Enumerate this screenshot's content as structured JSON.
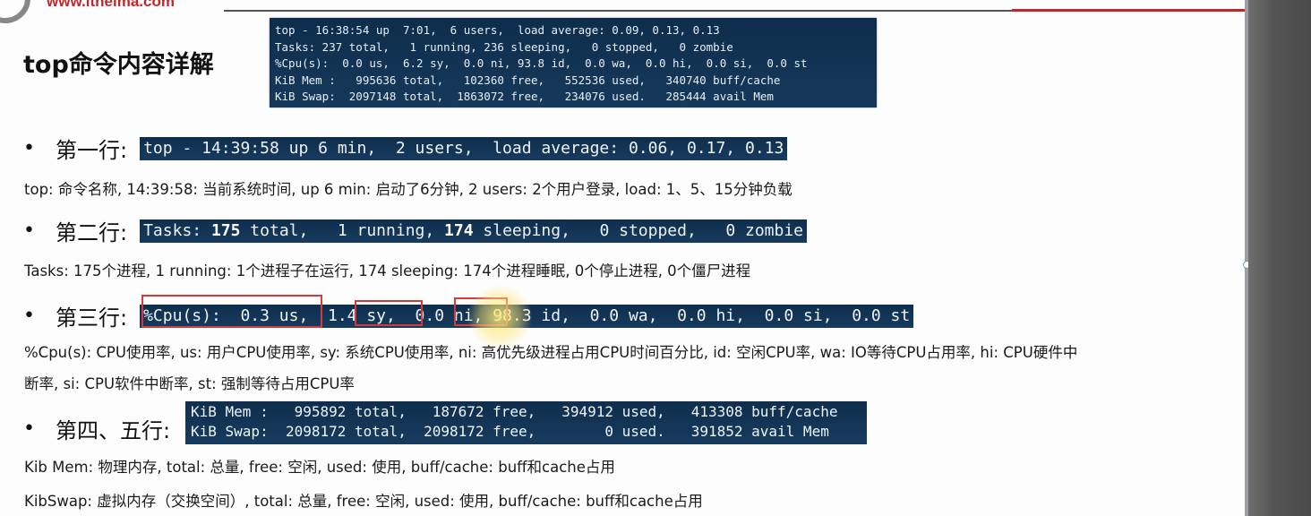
{
  "header": {
    "site": "www.itheima.com"
  },
  "title": "top命令内容详解",
  "top_terminal": [
    "top - 16:38:54 up  7:01,  6 users,  load average: 0.09, 0.13, 0.13",
    "Tasks: 237 total,   1 running, 236 sleeping,   0 stopped,   0 zombie",
    "%Cpu(s):  0.0 us,  6.2 sy,  0.0 ni, 93.8 id,  0.0 wa,  0.0 hi,  0.0 si,  0.0 st",
    "KiB Mem :   995636 total,   102360 free,   552536 used,   340740 buff/cache",
    "KiB Swap:  2097148 total,  1863072 free,   234076 used.   285444 avail Mem"
  ],
  "rows": {
    "row1": {
      "label": "第一行:",
      "line": "top - 14:39:58 up 6 min,  2 users,  load average: 0.06, 0.17, 0.13",
      "desc": "top: 命令名称, 14:39:58: 当前系统时间, up 6 min: 启动了6分钟, 2 users: 2个用户登录, load: 1、5、15分钟负载"
    },
    "row2": {
      "label": "第二行:",
      "line_parts": [
        "Tasks: ",
        "175",
        " total,   1 running, ",
        "174",
        " sleeping,   0 stopped,   0 zombie"
      ],
      "desc": "Tasks: 175个进程, 1 running: 1个进程子在运行, 174 sleeping: 174个进程睡眠, 0个停止进程, 0个僵尸进程"
    },
    "row3": {
      "label": "第三行:",
      "line": "%Cpu(s):  0.3 us,  1.4 sy,  0.0 ni, 98.3 id,  0.0 wa,  0.0 hi,  0.0 si,  0.0 st",
      "desc_line1": "%Cpu(s): CPU使用率, us: 用户CPU使用率, sy: 系统CPU使用率, ni: 高优先级进程占用CPU时间百分比, id: 空闲CPU率, wa: IO等待CPU占用率, hi: CPU硬件中",
      "desc_line2": "断率, si: CPU软件中断率, st: 强制等待占用CPU率"
    },
    "row45": {
      "label": "第四、五行:",
      "mem_lines": [
        "KiB Mem :   995892 total,   187672 free,   394912 used,   413308 buff/cache",
        "KiB Swap:  2098172 total,  2098172 free,        0 used.   391852 avail Mem"
      ],
      "desc_mem": "Kib Mem: 物理内存, total: 总量, free: 空闲, used: 使用, buff/cache: buff和cache占用",
      "desc_swap": "KibSwap: 虚拟内存（交换空间）, total: 总量, free: 空闲, used: 使用, buff/cache: buff和cache占用"
    }
  },
  "colors": {
    "terminal_bg": "#16395b",
    "highlight_box": "#d33a3a",
    "brand_red": "#c0272d"
  }
}
